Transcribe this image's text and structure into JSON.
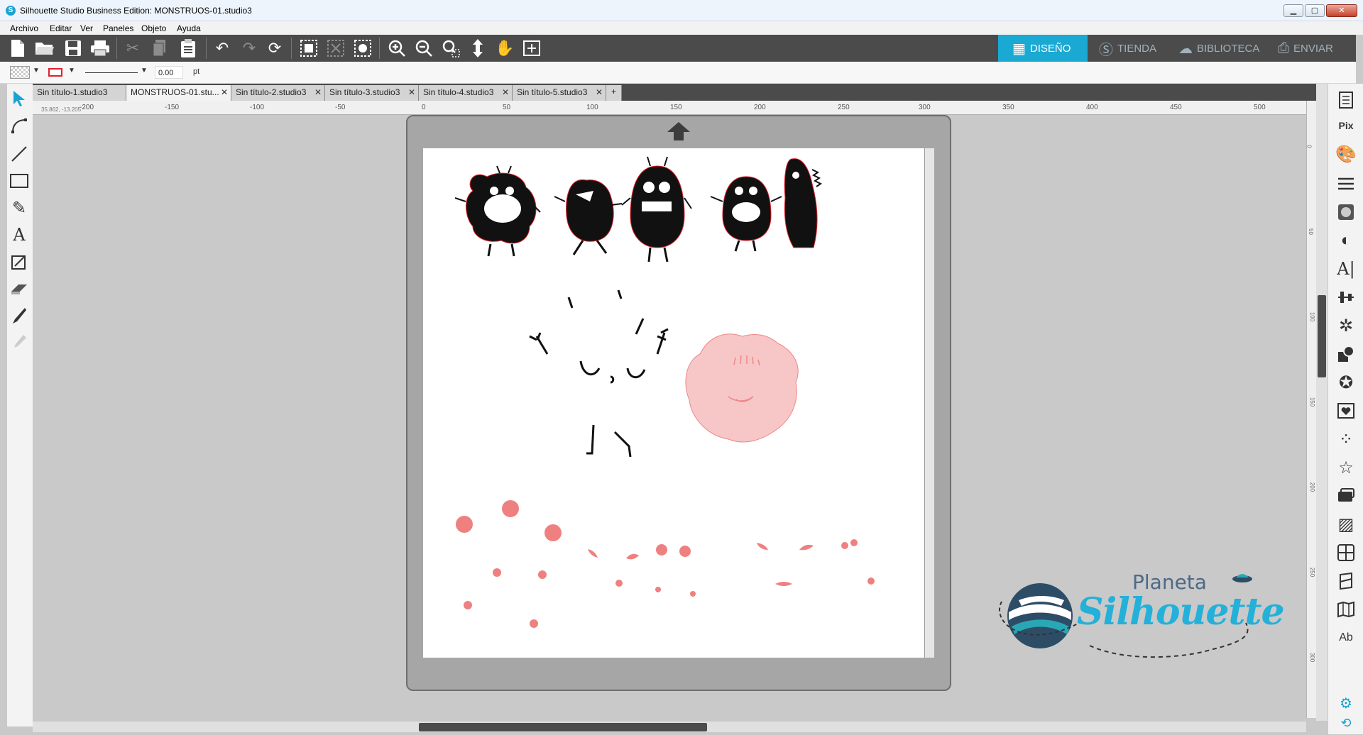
{
  "window": {
    "title": "Silhouette Studio Business Edition: MONSTRUOS-01.studio3",
    "controls": {
      "minimize": "▁",
      "maximize": "▢",
      "close": "✕"
    }
  },
  "menu": [
    "Archivo",
    "Editar",
    "Ver",
    "Paneles",
    "Objeto",
    "Ayuda"
  ],
  "nav_tabs": [
    {
      "label": "DISEÑO",
      "active": true
    },
    {
      "label": "TIENDA",
      "active": false
    },
    {
      "label": "BIBLIOTECA",
      "active": false
    },
    {
      "label": "ENVIAR",
      "active": false
    }
  ],
  "propbar": {
    "line_width": "0.00",
    "unit": "pt"
  },
  "doc_tabs": [
    {
      "label": "Sin título-1.studio3",
      "active": false
    },
    {
      "label": "MONSTRUOS-01.stu...",
      "active": true
    },
    {
      "label": "Sin título-2.studio3",
      "active": false
    },
    {
      "label": "Sin título-3.studio3",
      "active": false
    },
    {
      "label": "Sin título-4.studio3",
      "active": false
    },
    {
      "label": "Sin título-5.studio3",
      "active": false
    }
  ],
  "ruler": {
    "coords": "35.862, -13.205",
    "h_ticks": [
      "-200",
      "-150",
      "-100",
      "-50",
      "0",
      "50",
      "100",
      "150",
      "200",
      "250",
      "300",
      "350",
      "400",
      "450",
      "500"
    ],
    "v_ticks": [
      "0",
      "50",
      "100",
      "150",
      "200",
      "250",
      "300"
    ]
  },
  "logo": {
    "line1": "Planeta",
    "line2": "Silhouette"
  },
  "colors": {
    "accent": "#1aa9d2",
    "toolbar": "#4b4b4b",
    "pink": "#f0a0a0",
    "cut_line": "#e0202a"
  }
}
